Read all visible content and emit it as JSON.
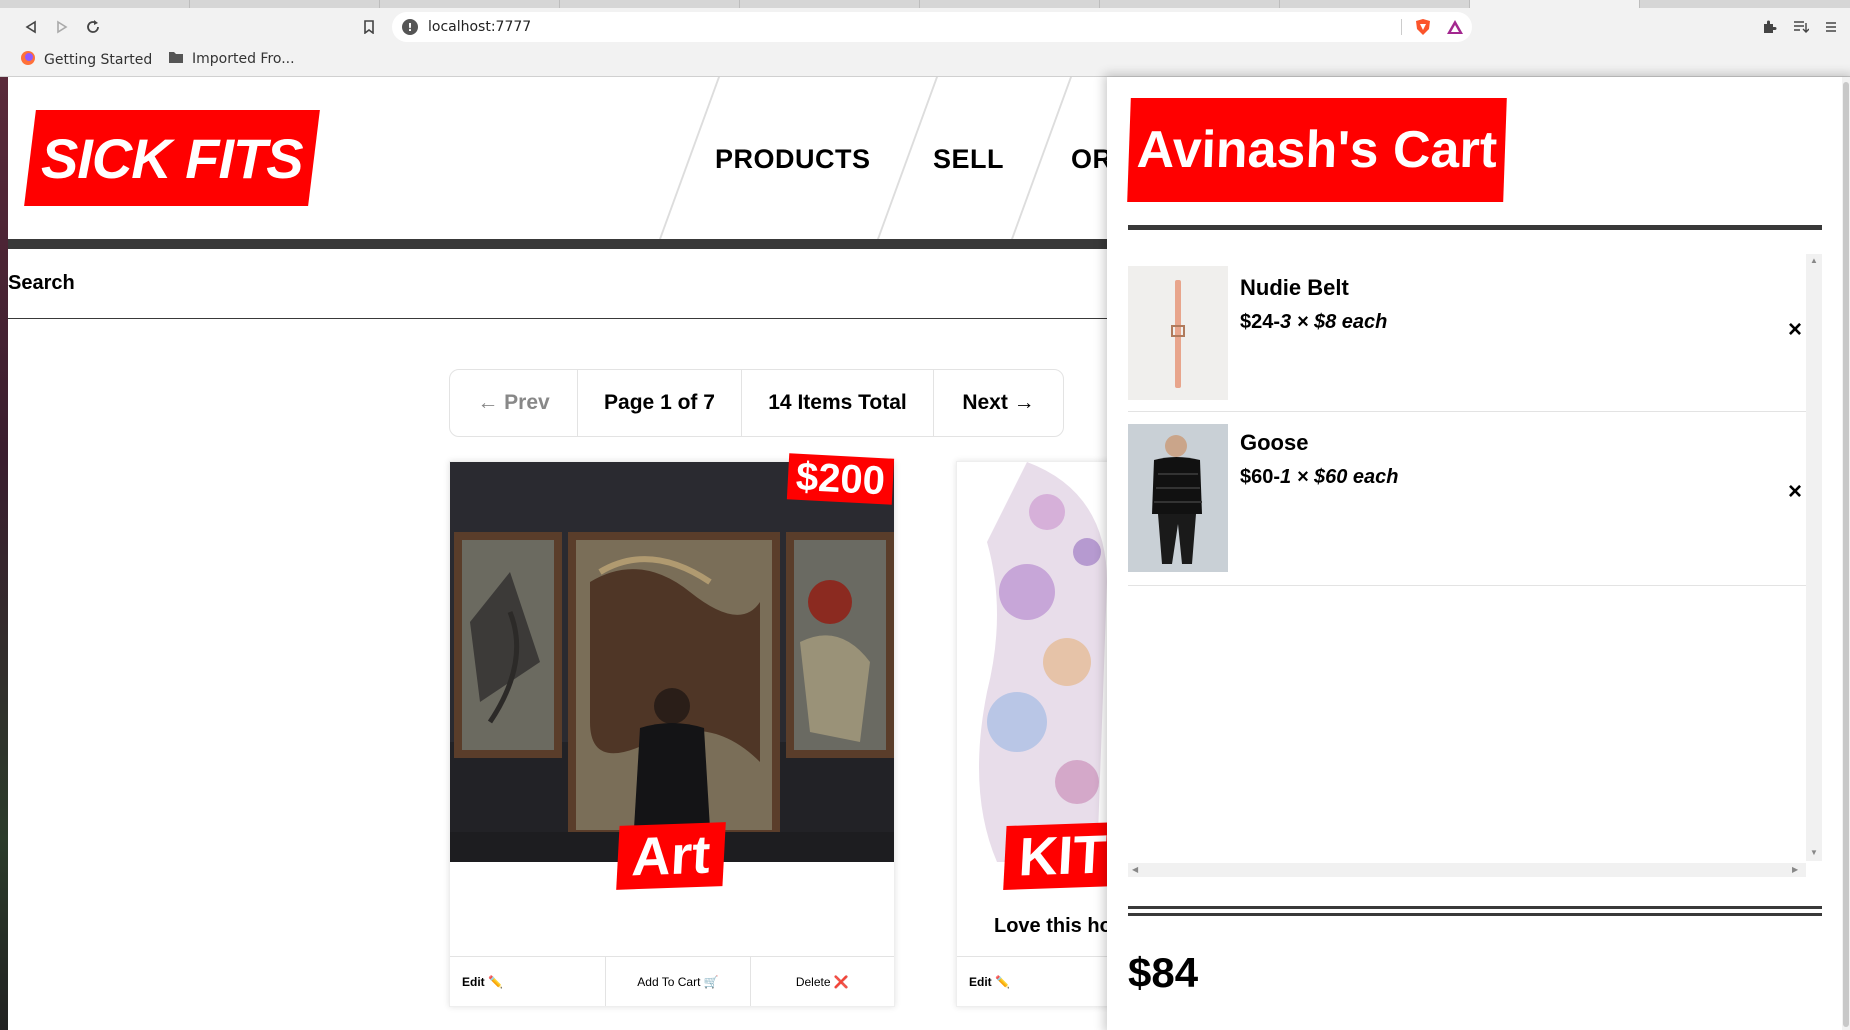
{
  "browser": {
    "url": "localhost:7777",
    "bookmarks": [
      "Getting Started",
      "Imported Fro..."
    ]
  },
  "site": {
    "logo": "SICK FITS",
    "nav": [
      "PRODUCTS",
      "SELL",
      "OR"
    ],
    "search_label": "Search"
  },
  "pagination": {
    "prev": "← Prev",
    "page": "Page 1 of 7",
    "total": "14 Items Total",
    "next": "Next →"
  },
  "products": [
    {
      "title": "Art",
      "price": "$200",
      "buttons": {
        "edit": "Edit ✏️",
        "add": "Add To Cart 🛒",
        "delete": "Delete ❌"
      }
    },
    {
      "title": "KIT",
      "description": "Love this ho",
      "buttons": {
        "edit": "Edit ✏️"
      }
    }
  ],
  "cart": {
    "title": "Avinash's Cart",
    "close": "×",
    "items": [
      {
        "name": "Nudie Belt",
        "total": "$24",
        "detail": "3 × $8 each",
        "remove": "×"
      },
      {
        "name": "Goose",
        "total": "$60",
        "detail": "1 × $60 each",
        "remove": "×"
      }
    ],
    "total": "$84"
  },
  "colors": {
    "brand_red": "#ff0000",
    "dark_bar": "#393939"
  }
}
